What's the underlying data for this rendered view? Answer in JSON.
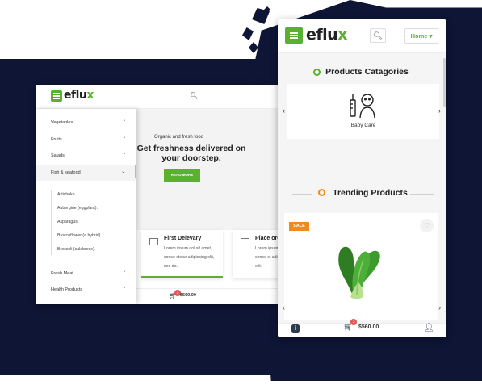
{
  "colors": {
    "brand_green": "#5bb12f",
    "sale_orange": "#f08a1c",
    "navy": "#0e1535",
    "badge_red": "#e05656"
  },
  "desktop": {
    "logo": {
      "text": "eflu",
      "accent": "x"
    },
    "search_icon": "search-icon",
    "categories": [
      {
        "label": "Vegetables",
        "arrow": "›"
      },
      {
        "label": "Fruits",
        "arrow": "›"
      },
      {
        "label": "Salads",
        "arrow": "›"
      },
      {
        "label": "Fish & seafood",
        "arrow": "⌄"
      }
    ],
    "subitems": [
      "Artichoke.",
      "Aubergine (eggplant).",
      "Asparagus.",
      "Broccoflower (a hybrid).",
      "Broccoli (calabrese)."
    ],
    "categories_lower": [
      {
        "label": "Fresh Meat",
        "arrow": "›"
      },
      {
        "label": "Health Products",
        "arrow": "›"
      }
    ],
    "hero": {
      "kicker": "Organic and fresh food",
      "title": "Get freshness delivered on your doorstep.",
      "button": "READ MORE"
    },
    "features": [
      {
        "title": "First Delevary",
        "body": "Lorem ipsum dol sit amet, conse ctetur adipiscing elit, sed do."
      },
      {
        "title": "Place orc",
        "body": "Lorem ipsum d amet, conse ct adipiscing elit."
      }
    ],
    "cart": {
      "count": "3",
      "price": "$560.00"
    }
  },
  "mobile": {
    "logo": {
      "text": "eflu",
      "accent": "x"
    },
    "home_label": "Home",
    "home_caret": "▾",
    "section_categories": "Products Catagories",
    "category_item": "Baby Care",
    "section_trending": "Trending Products",
    "sale_badge": "SALE",
    "cart": {
      "count": "3",
      "price": "$560.00"
    },
    "prev_arrow": "‹",
    "next_arrow": "›"
  }
}
